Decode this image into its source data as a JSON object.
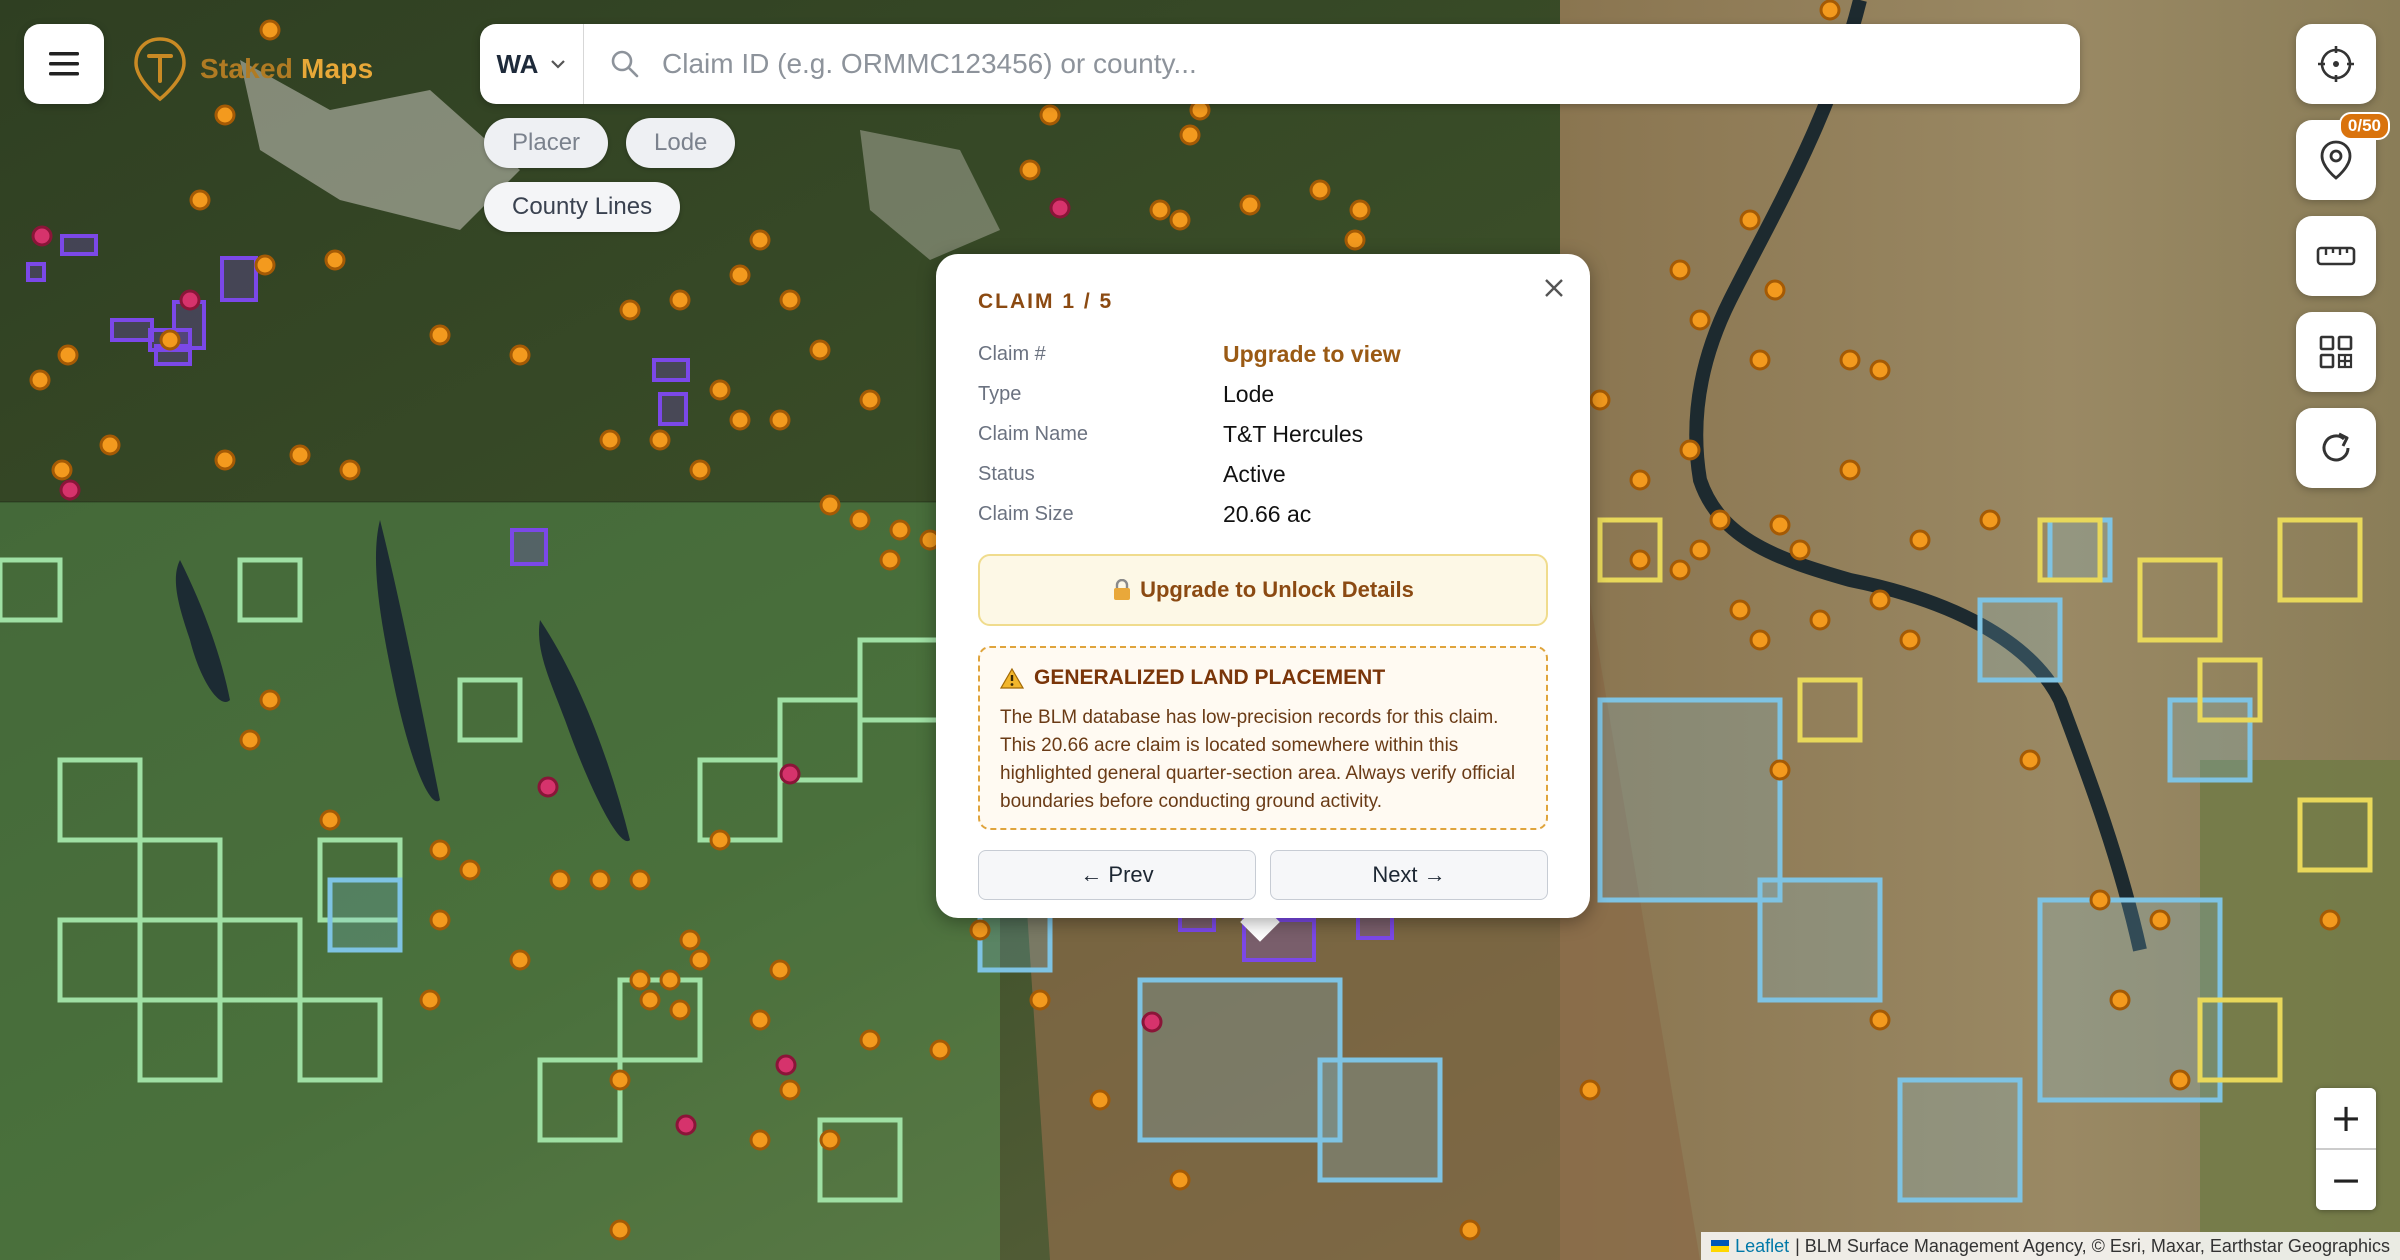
{
  "app": {
    "name_part1": "Staked",
    "name_part2": "Maps"
  },
  "search": {
    "state": "WA",
    "placeholder": "Claim ID (e.g. ORMMC123456) or county..."
  },
  "filters": [
    {
      "label": "Placer",
      "active": false
    },
    {
      "label": "Lode",
      "active": false
    },
    {
      "label": "County Lines",
      "active": true
    }
  ],
  "toolbar": {
    "locate": "crosshair-icon",
    "saved": {
      "icon": "map-pin-icon",
      "badge": "0/50"
    },
    "measure": "ruler-icon",
    "layers": "grid-icon",
    "refresh": "refresh-icon"
  },
  "zoom": {
    "in_label": "+",
    "out_label": "−"
  },
  "attribution": {
    "link": "Leaflet",
    "text": "| BLM Surface Management Agency, © Esri, Maxar, Earthstar Geographics"
  },
  "popup": {
    "title": "CLAIM 1 / 5",
    "fields": [
      {
        "key": "Claim #",
        "value": "Upgrade to view",
        "link": true
      },
      {
        "key": "Type",
        "value": "Lode",
        "link": false
      },
      {
        "key": "Claim Name",
        "value": "T&T Hercules",
        "link": false
      },
      {
        "key": "Status",
        "value": "Active",
        "link": false
      },
      {
        "key": "Claim Size",
        "value": "20.66 ac",
        "link": false
      }
    ],
    "upgrade_label": "Upgrade to Unlock Details",
    "warning_title": "GENERALIZED LAND PLACEMENT",
    "warning_body": "The BLM database has low-precision records for this claim. This 20.66 acre claim is located somewhere within this highlighted general quarter-section area. Always verify official boundaries before conducting ground activity.",
    "prev_label": "← Prev",
    "next_label": "Next →"
  },
  "colors": {
    "claim_orange": "#f39a1e",
    "claim_magenta": "#d6336c",
    "claim_purple": "#7b48e8",
    "blm_green": "#9fe0a4",
    "blm_blue": "#7ec3e3",
    "blm_yellow": "#e8d85a",
    "accent": "#8b4a12"
  }
}
